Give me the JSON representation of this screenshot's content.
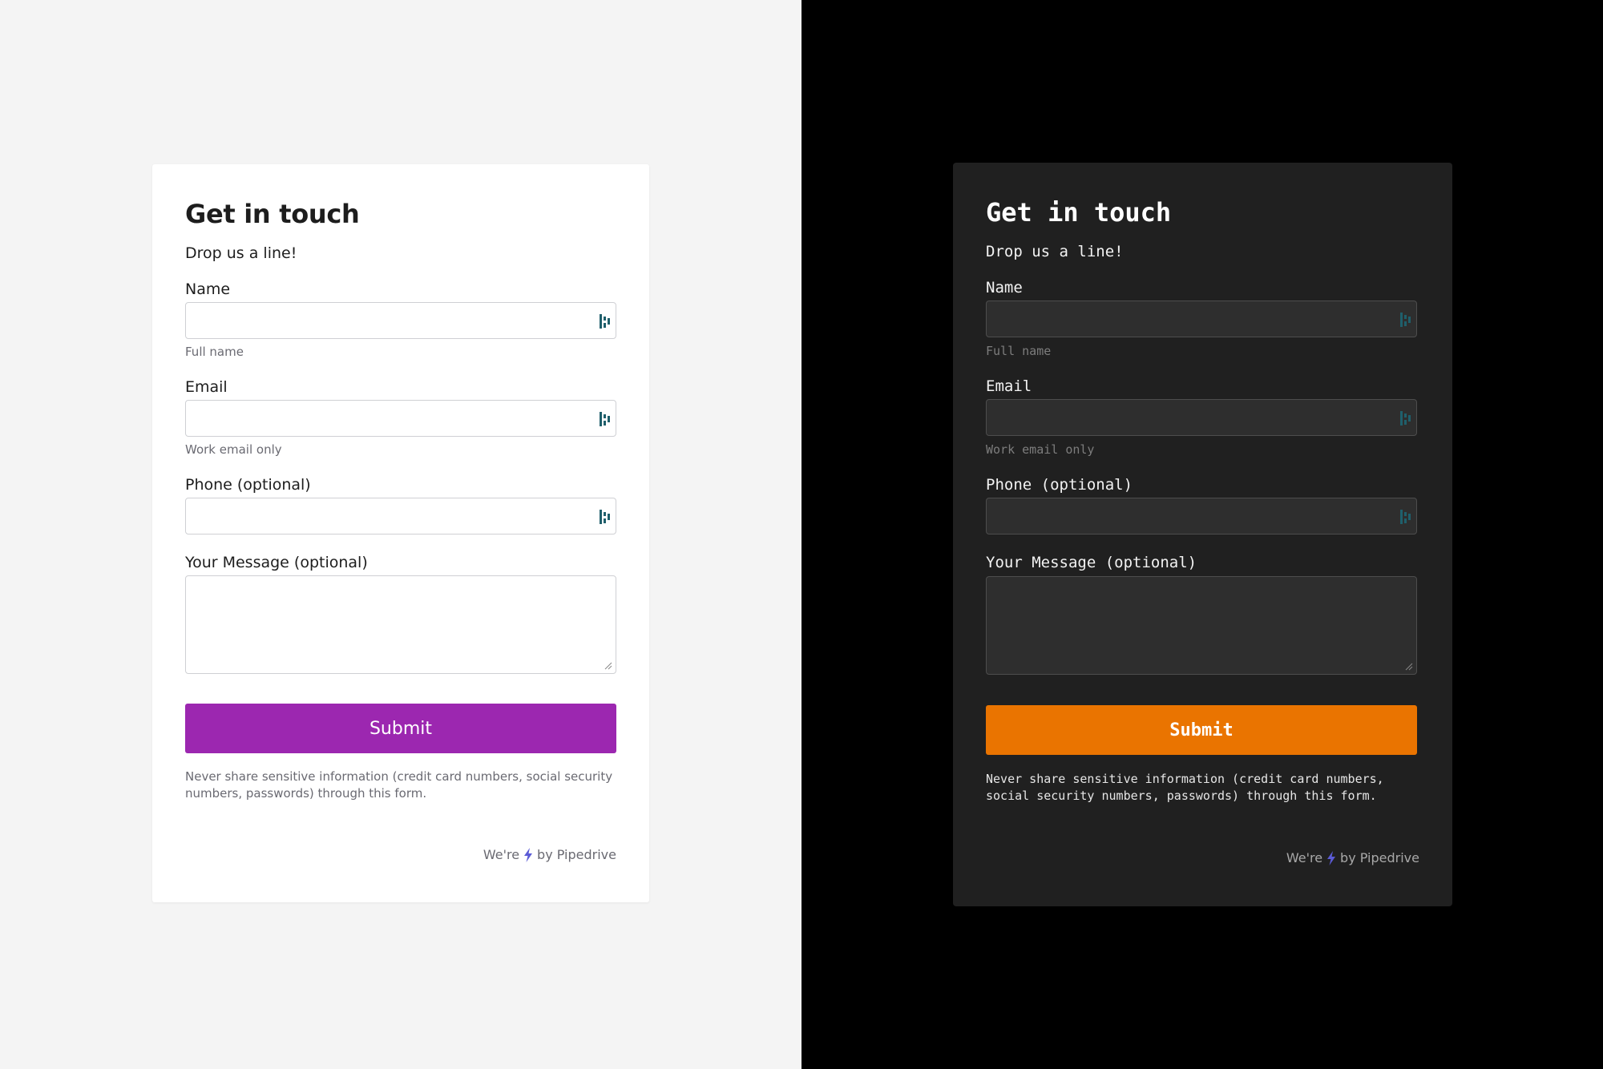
{
  "light_form": {
    "title": "Get in touch",
    "subtitle": "Drop us a line!",
    "name_label": "Name",
    "name_hint": "Full name",
    "email_label": "Email",
    "email_hint": "Work email only",
    "phone_label": "Phone (optional)",
    "message_label": "Your Message (optional)",
    "submit_label": "Submit",
    "disclaimer": "Never share sensitive information (credit card numbers, social security numbers, passwords) through this form.",
    "powered_prefix": "We're",
    "powered_suffix": "by Pipedrive"
  },
  "dark_form": {
    "title": "Get in touch",
    "subtitle": "Drop us a line!",
    "name_label": "Name",
    "name_hint": "Full name",
    "email_label": "Email",
    "email_hint": "Work email only",
    "phone_label": "Phone (optional)",
    "message_label": "Your Message (optional)",
    "submit_label": "Submit",
    "disclaimer": "Never share sensitive information (credit card numbers, social security numbers, passwords) through this form.",
    "powered_prefix": "We're",
    "powered_suffix": "by Pipedrive"
  },
  "colors": {
    "light_background": "#f4f4f4",
    "light_card": "#ffffff",
    "light_submit": "#9c27b0",
    "dark_background": "#000000",
    "dark_card": "#202020",
    "dark_submit": "#ea7400",
    "bolt": "#5b5bd6",
    "field_icon": "#1f5f6b"
  },
  "icons": {
    "field_icon": "pipedrive-autofill-icon",
    "powered_icon": "lightning-bolt-icon",
    "resize_icon": "resize-grip-icon"
  }
}
